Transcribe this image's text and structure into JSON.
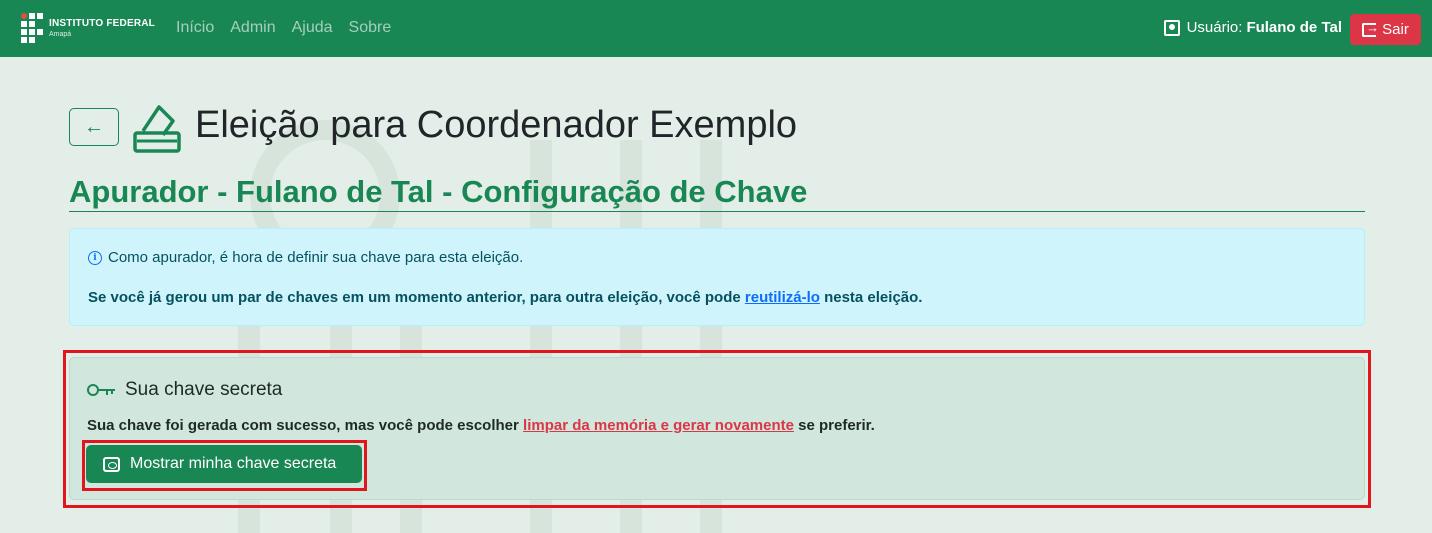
{
  "brand": {
    "name": "INSTITUTO FEDERAL",
    "campus": "Amapá"
  },
  "nav": {
    "items": [
      "Início",
      "Admin",
      "Ajuda",
      "Sobre"
    ]
  },
  "user": {
    "label": "Usuário:",
    "name": "Fulano de Tal",
    "logout_label": "Sair"
  },
  "header": {
    "back_icon": "arrow-left-icon",
    "title": "Eleição para Coordenador Exemplo",
    "subtitle": "Apurador - Fulano de Tal - Configuração de Chave"
  },
  "info_alert": {
    "line1": "Como apurador, é hora de definir sua chave para esta eleição.",
    "line2_before": "Se você já gerou um par de chaves em um momento anterior, para outra eleição, você pode ",
    "line2_link": "reutilizá-lo",
    "line2_after": " nesta eleição."
  },
  "secret_card": {
    "heading": "Sua chave secreta",
    "msg_before": "Sua chave foi gerada com sucesso, mas você pode escolher ",
    "msg_link": "limpar da memória e gerar novamente",
    "msg_after": " se preferir.",
    "button_label": "Mostrar minha chave secreta"
  },
  "colors": {
    "primary": "#198754",
    "danger": "#dc3545",
    "info_bg": "#cff4fc",
    "success_bg": "#d1e7dd",
    "highlight": "#e1161c"
  }
}
